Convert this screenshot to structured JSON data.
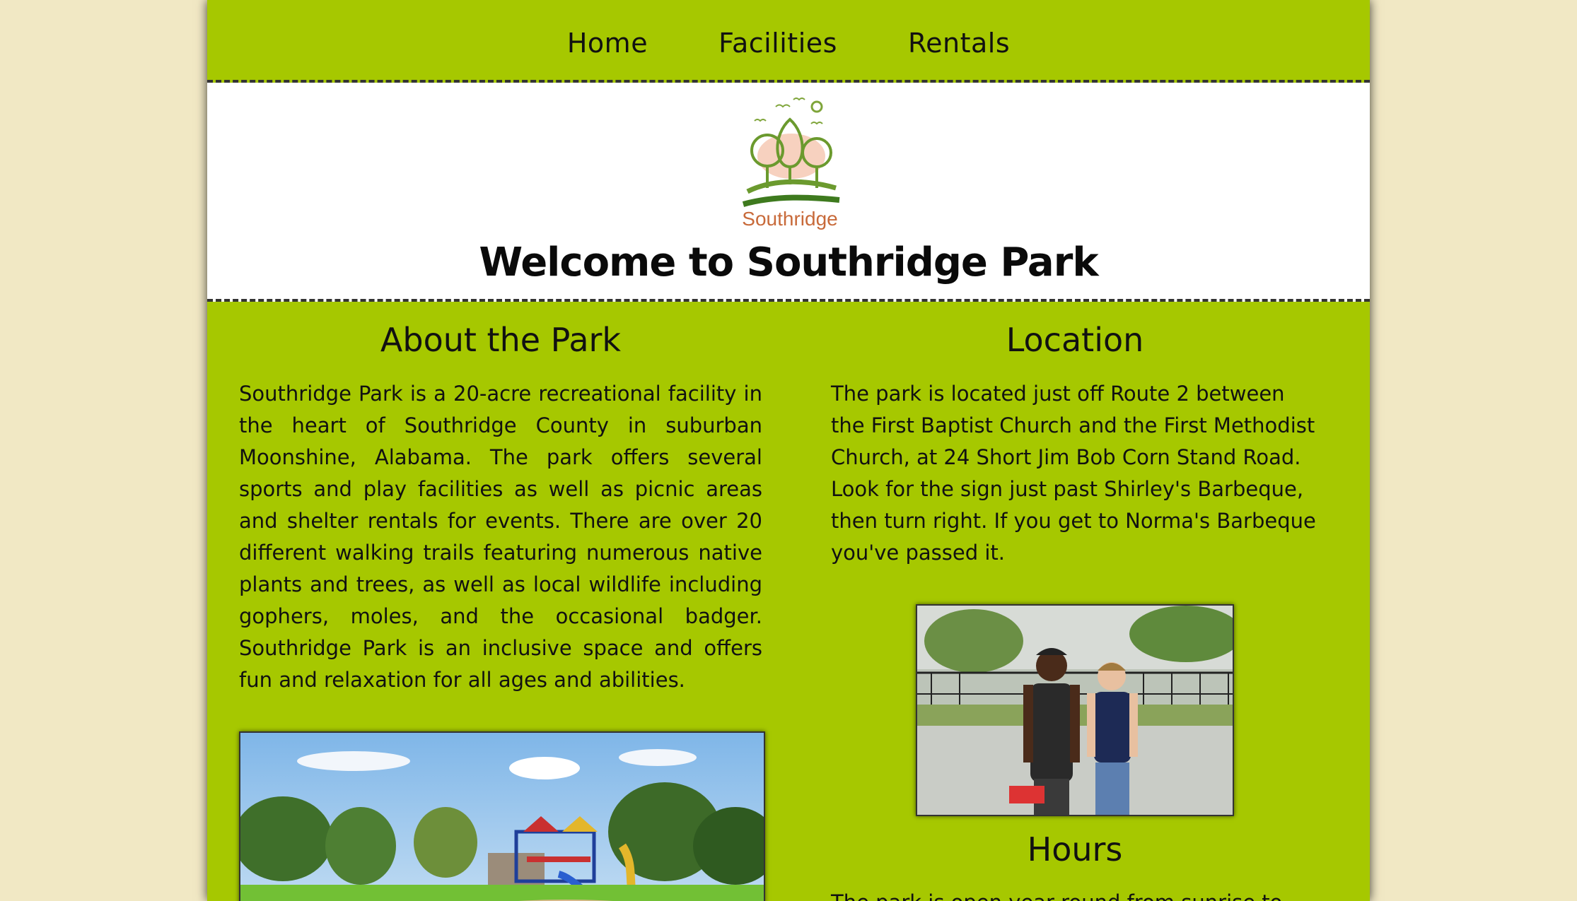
{
  "nav": {
    "items": [
      {
        "label": "Home"
      },
      {
        "label": "Facilities"
      },
      {
        "label": "Rentals"
      }
    ]
  },
  "header": {
    "logo_text": "Southridge",
    "welcome": "Welcome to Southridge Park"
  },
  "about": {
    "title": "About the Park",
    "text": "Southridge Park is a 20-acre recreational facility in the heart of Southridge County in suburban Moonshine, Alabama. The park offers several sports and play facilities as well as picnic areas and shelter rentals for events. There are over 20 different walking trails featuring numerous native plants and trees, as well as local wildlife including gophers, moles, and the occasional badger. Southridge Park is an inclusive space and offers fun and relaxation for all ages and abilities."
  },
  "location": {
    "title": "Location",
    "text": "The park is located just off Route 2 between the First Baptist Church and the First Methodist Church, at 24 Short Jim Bob Corn Stand Road. Look for the sign just past Shirley's Barbeque, then turn right. If you get to Norma's Barbeque you've passed it."
  },
  "hours": {
    "title": "Hours",
    "text": "The park is open year round from sunrise to"
  },
  "colors": {
    "background": "#f1e8c4",
    "page_green": "#a6c800",
    "header_white": "#ffffff"
  }
}
